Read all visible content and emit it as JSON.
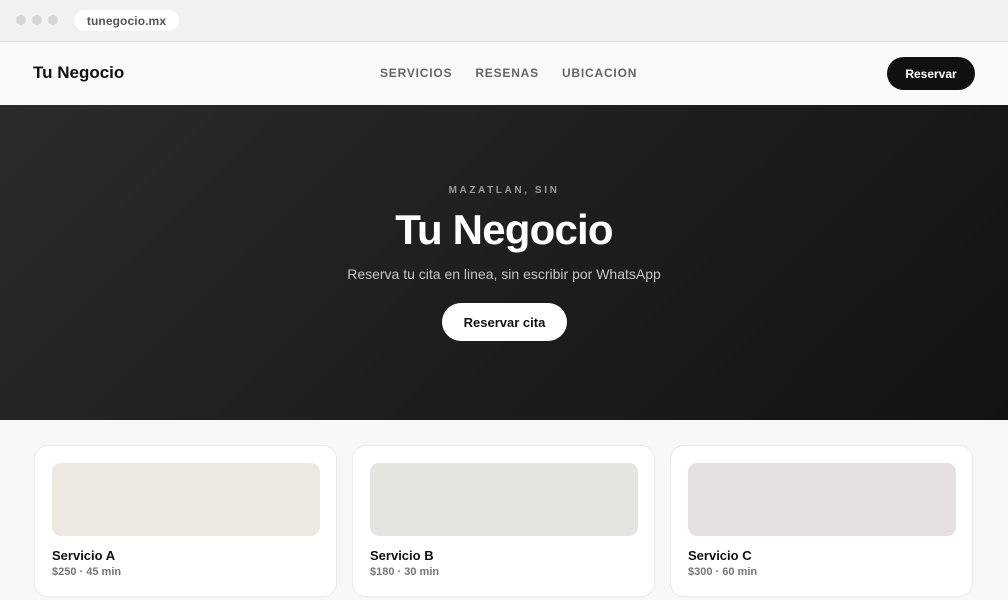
{
  "browser": {
    "url": "tunegocio.mx"
  },
  "navbar": {
    "brand": "Tu Negocio",
    "links": [
      "SERVICIOS",
      "RESENAS",
      "UBICACION"
    ],
    "cta_label": "Reservar"
  },
  "hero": {
    "kicker": "MAZATLAN, SIN",
    "title": "Tu Negocio",
    "subtitle": "Reserva tu cita en linea, sin escribir por WhatsApp",
    "cta_label": "Reservar cita"
  },
  "services": [
    {
      "name": "Servicio A",
      "meta": "$250 · 45 min",
      "thumb_color": "#ede8e1"
    },
    {
      "name": "Servicio B",
      "meta": "$180 · 30 min",
      "thumb_color": "#e4e5e1"
    },
    {
      "name": "Servicio C",
      "meta": "$300 · 60 min",
      "thumb_color": "#e6e0e4"
    }
  ]
}
